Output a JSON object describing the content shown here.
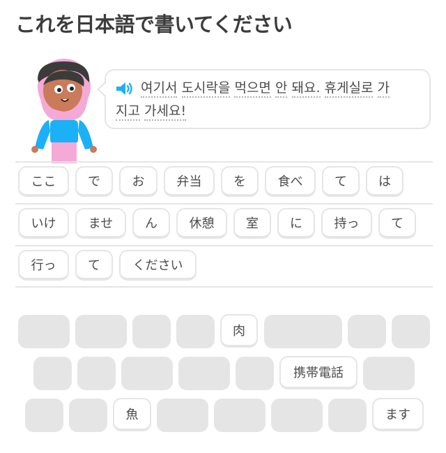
{
  "title": "これを日本語で書いてください",
  "prompt": {
    "line1": [
      "여기서",
      "도시락을",
      "먹으면",
      "안",
      "돼요.",
      "휴게실로",
      "가"
    ],
    "line2": [
      "지고",
      "가세요!"
    ]
  },
  "answer_tiles": [
    "ここ",
    "で",
    "お",
    "弁当",
    "を",
    "食べ",
    "て",
    "は",
    "いけ",
    "ませ",
    "ん",
    "休憩",
    "室",
    "に",
    "持っ",
    "て",
    "行っ",
    "て",
    "ください"
  ],
  "bank_tiles": [
    "肉",
    "携帯電話",
    "魚",
    "ます"
  ],
  "colors": {
    "border": "#e5e5e5",
    "speaker": "#1cb0f6",
    "text": "#4b4b4b"
  }
}
